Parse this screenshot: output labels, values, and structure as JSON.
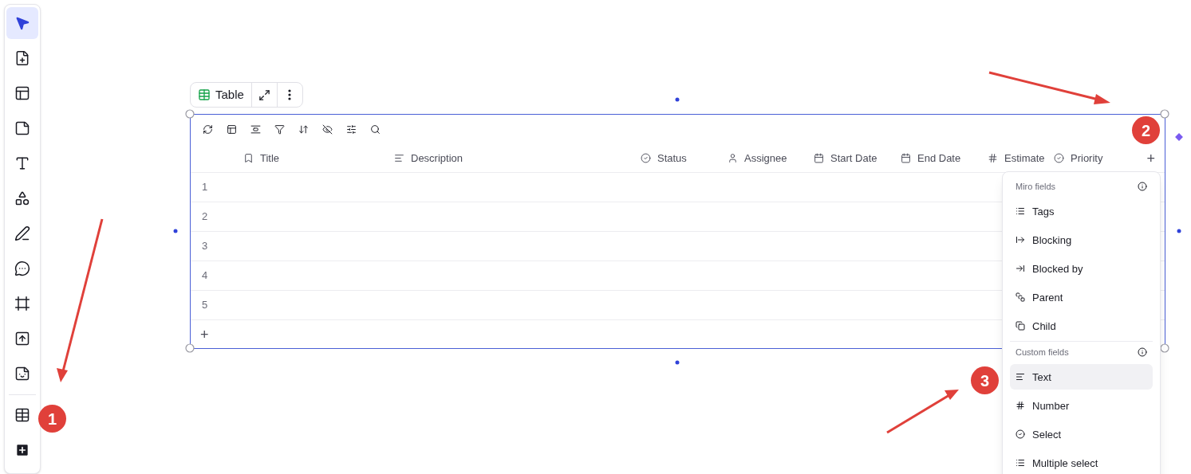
{
  "toolbar": {
    "tools": [
      {
        "selected": true
      },
      {
        "selected": false
      },
      {
        "selected": false
      },
      {
        "selected": false
      },
      {
        "selected": false
      },
      {
        "selected": false
      },
      {
        "selected": false
      },
      {
        "selected": false
      },
      {
        "selected": false
      },
      {
        "selected": false
      },
      {
        "selected": false
      }
    ],
    "extras": [
      {
        "selected": false
      },
      {
        "selected": false
      }
    ]
  },
  "widget_bar": {
    "label": "Table"
  },
  "table": {
    "columns": [
      "Title",
      "Description",
      "Status",
      "Assignee",
      "Start Date",
      "End Date",
      "Estimate",
      "Priority"
    ],
    "add_column": "+",
    "rows": [
      "1",
      "2",
      "3",
      "4",
      "5"
    ],
    "add_row": "+"
  },
  "field_menu": {
    "sections": [
      {
        "heading": "Miro fields",
        "items": [
          {
            "label": "Tags",
            "selected": false
          },
          {
            "label": "Blocking",
            "selected": false
          },
          {
            "label": "Blocked by",
            "selected": false
          },
          {
            "label": "Parent",
            "selected": false
          },
          {
            "label": "Child",
            "selected": false
          }
        ]
      },
      {
        "heading": "Custom fields",
        "items": [
          {
            "label": "Text",
            "selected": true
          },
          {
            "label": "Number",
            "selected": false
          },
          {
            "label": "Select",
            "selected": false
          },
          {
            "label": "Multiple select",
            "selected": false
          }
        ]
      }
    ]
  },
  "annotations": [
    "1",
    "2",
    "3"
  ]
}
